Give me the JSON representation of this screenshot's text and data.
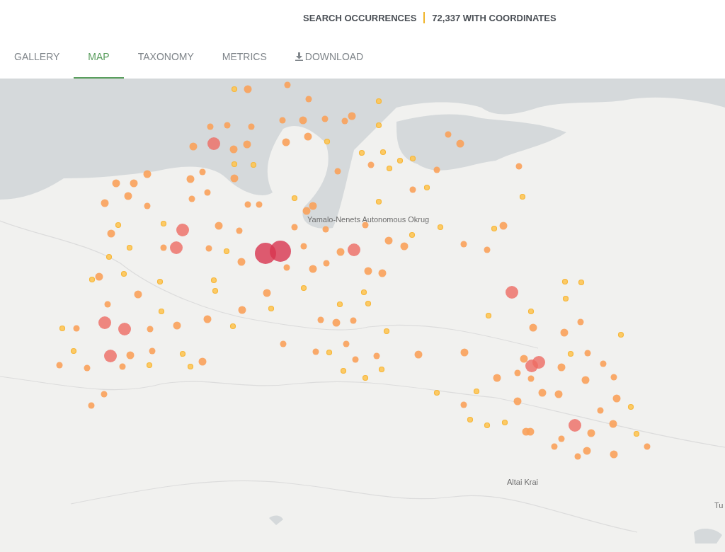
{
  "header": {
    "title": "SEARCH OCCURRENCES",
    "count": "72,337 WITH COORDINATES"
  },
  "tabs": [
    {
      "label": "GALLERY",
      "selected": false,
      "kind": "text"
    },
    {
      "label": "MAP",
      "selected": true,
      "kind": "text"
    },
    {
      "label": "TAXONOMY",
      "selected": false,
      "kind": "text"
    },
    {
      "label": "METRICS",
      "selected": false,
      "kind": "text"
    },
    {
      "label": "DOWNLOAD",
      "selected": false,
      "kind": "download"
    }
  ],
  "map": {
    "labels": [
      "Yamalo-Nenets Autonomous Okrug",
      "Altai Krai",
      "Tu"
    ]
  }
}
